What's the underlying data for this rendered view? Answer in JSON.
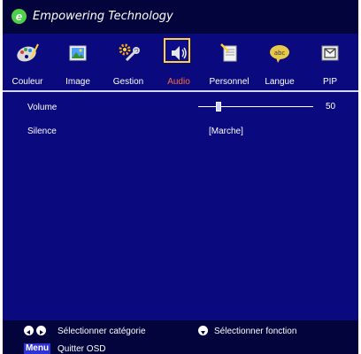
{
  "header": {
    "brand": "Empowering Technology",
    "logo_letter": "e"
  },
  "tabs": [
    {
      "label": "Couleur",
      "icon": "palette-icon"
    },
    {
      "label": "Image",
      "icon": "image-icon"
    },
    {
      "label": "Gestion",
      "icon": "settings-icon"
    },
    {
      "label": "Audio",
      "icon": "speaker-icon",
      "active": true
    },
    {
      "label": "Personnel",
      "icon": "notebook-icon"
    },
    {
      "label": "Langue",
      "icon": "language-icon"
    },
    {
      "label": "PIP",
      "icon": "pip-icon"
    }
  ],
  "settings": {
    "volume": {
      "label": "Volume",
      "value": "50",
      "level": 0.18
    },
    "silence": {
      "label": "Silence",
      "value": "[Marche]"
    }
  },
  "footer": {
    "select_category": "Sélectionner catégorie",
    "select_function": "Sélectionner fonction",
    "menu_key": "Menu",
    "quit": "Quitter OSD"
  },
  "colors": {
    "background": "#0a0a7e",
    "bar": "#04043c",
    "active_label": "#ff6a3a",
    "active_border": "#ffd23a"
  }
}
